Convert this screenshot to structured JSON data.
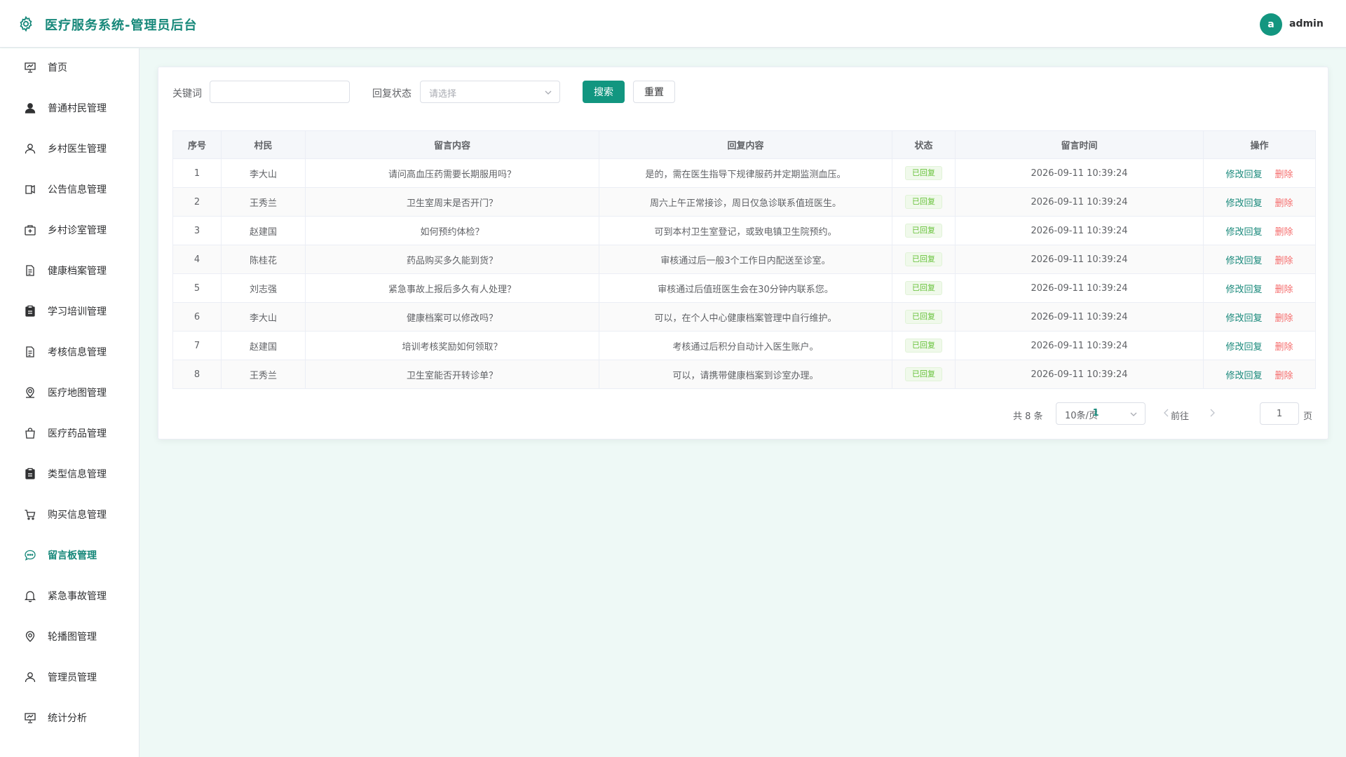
{
  "header": {
    "title": "医疗服务系统-管理员后台",
    "avatar_initial": "a",
    "username": "admin"
  },
  "sidebar": {
    "items": [
      {
        "label": "首页",
        "icon": "dashboard-icon"
      },
      {
        "label": "普通村民管理",
        "icon": "user-filled-icon"
      },
      {
        "label": "乡村医生管理",
        "icon": "user-icon"
      },
      {
        "label": "公告信息管理",
        "icon": "notice-icon"
      },
      {
        "label": "乡村诊室管理",
        "icon": "clinic-icon"
      },
      {
        "label": "健康档案管理",
        "icon": "document-icon"
      },
      {
        "label": "学习培训管理",
        "icon": "clipboard-icon"
      },
      {
        "label": "考核信息管理",
        "icon": "document-icon"
      },
      {
        "label": "医疗地图管理",
        "icon": "map-location-icon"
      },
      {
        "label": "医疗药品管理",
        "icon": "shopping-bag-icon"
      },
      {
        "label": "类型信息管理",
        "icon": "clipboard-icon"
      },
      {
        "label": "购买信息管理",
        "icon": "shopping-cart-icon"
      },
      {
        "label": "留言板管理",
        "icon": "chat-icon",
        "active": true
      },
      {
        "label": "紧急事故管理",
        "icon": "bell-icon"
      },
      {
        "label": "轮播图管理",
        "icon": "location-icon"
      },
      {
        "label": "管理员管理",
        "icon": "user-icon"
      },
      {
        "label": "统计分析",
        "icon": "dashboard-icon"
      }
    ]
  },
  "filters": {
    "keyword_label": "关键词",
    "keyword_value": "",
    "status_label": "回复状态",
    "status_placeholder": "请选择",
    "search_label": "搜索",
    "reset_label": "重置"
  },
  "table": {
    "columns": [
      "序号",
      "村民",
      "留言内容",
      "回复内容",
      "状态",
      "留言时间",
      "操作"
    ],
    "edit_label": "修改回复",
    "delete_label": "删除",
    "rows": [
      {
        "no": "1",
        "villager": "李大山",
        "message": "请问高血压药需要长期服用吗？",
        "reply": "是的，需在医生指导下规律服药并定期监测血压。",
        "status": "已回复",
        "time": "2026-09-11 10:39:24"
      },
      {
        "no": "2",
        "villager": "王秀兰",
        "message": "卫生室周末是否开门？",
        "reply": "周六上午正常接诊，周日仅急诊联系值班医生。",
        "status": "已回复",
        "time": "2026-09-11 10:39:24"
      },
      {
        "no": "3",
        "villager": "赵建国",
        "message": "如何预约体检？",
        "reply": "可到本村卫生室登记，或致电镇卫生院预约。",
        "status": "已回复",
        "time": "2026-09-11 10:39:24"
      },
      {
        "no": "4",
        "villager": "陈桂花",
        "message": "药品购买多久能到货？",
        "reply": "审核通过后一般3个工作日内配送至诊室。",
        "status": "已回复",
        "time": "2026-09-11 10:39:24"
      },
      {
        "no": "5",
        "villager": "刘志强",
        "message": "紧急事故上报后多久有人处理？",
        "reply": "审核通过后值班医生会在30分钟内联系您。",
        "status": "已回复",
        "time": "2026-09-11 10:39:24"
      },
      {
        "no": "6",
        "villager": "李大山",
        "message": "健康档案可以修改吗？",
        "reply": "可以，在个人中心健康档案管理中自行维护。",
        "status": "已回复",
        "time": "2026-09-11 10:39:24"
      },
      {
        "no": "7",
        "villager": "赵建国",
        "message": "培训考核奖励如何领取？",
        "reply": "考核通过后积分自动计入医生账户。",
        "status": "已回复",
        "time": "2026-09-11 10:39:24"
      },
      {
        "no": "8",
        "villager": "王秀兰",
        "message": "卫生室能否开转诊单？",
        "reply": "可以，请携带健康档案到诊室办理。",
        "status": "已回复",
        "time": "2026-09-11 10:39:24"
      }
    ]
  },
  "pagination": {
    "total_text": "共 8 条",
    "page_size": "10条/页",
    "current_page": "1",
    "goto_label": "前往",
    "goto_value": "1",
    "page_unit": "页"
  },
  "colors": {
    "primary": "#129680",
    "accent_text": "#17887a",
    "danger": "#f56c6c",
    "success_tag": "#67c23a",
    "page_bg": "#eef9f6"
  }
}
